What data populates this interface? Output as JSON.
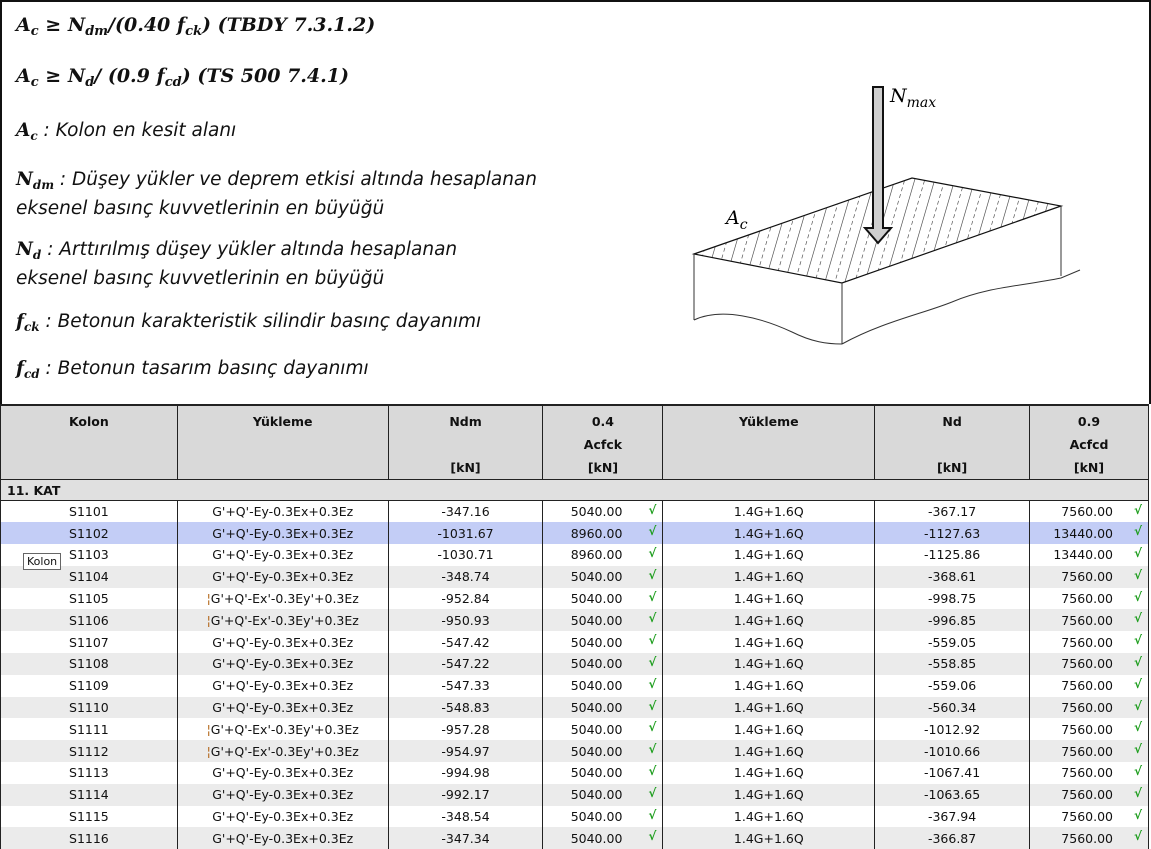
{
  "formulas": [
    {
      "seg": [
        [
          "A",
          "c"
        ],
        [
          " ≥ ",
          ""
        ],
        [
          "N",
          "dm"
        ],
        [
          "/(0.40 ",
          ""
        ],
        [
          "f",
          "ck"
        ],
        [
          ")  (TBDY 7.3.1.2)",
          ""
        ]
      ]
    },
    {
      "seg": [
        [
          "A",
          "c"
        ],
        [
          " ≥ ",
          ""
        ],
        [
          "N",
          "d"
        ],
        [
          "/ (0.9 ",
          ""
        ],
        [
          "f",
          "cd"
        ],
        [
          ")     (TS 500 7.4.1)",
          ""
        ]
      ]
    }
  ],
  "definitions": [
    {
      "sym": "A",
      "sub": "c",
      "lines": [
        " : Kolon en kesit alanı"
      ]
    },
    {
      "sym": "N",
      "sub": "dm",
      "lines": [
        " : Düşey yükler ve deprem etkisi altında hesaplanan",
        "eksenel basınç kuvvetlerinin en büyüğü"
      ]
    },
    {
      "sym": "N",
      "sub": "d",
      "lines": [
        " : Arttırılmış düşey yükler altında hesaplanan",
        "eksenel basınç kuvvetlerinin en büyüğü"
      ]
    },
    {
      "sym": "f",
      "sub": "ck",
      "lines": [
        " : Betonun karakteristik silindir basınç dayanımı"
      ]
    },
    {
      "sym": "f",
      "sub": "cd",
      "lines": [
        " : Betonun tasarım basınç dayanımı"
      ]
    }
  ],
  "diagram": {
    "load_label": "N",
    "load_sub": "max",
    "area_label": "A",
    "area_sub": "c"
  },
  "table": {
    "headers": [
      [
        "Kolon"
      ],
      [
        "Yükleme"
      ],
      [
        "Ndm",
        "",
        "[kN]"
      ],
      [
        "0.4",
        "Acfck",
        "[kN]"
      ],
      [
        "Yükleme"
      ],
      [
        "Nd",
        "",
        "[kN]"
      ],
      [
        "0.9",
        "Acfcd",
        "[kN]"
      ]
    ],
    "group": "11. KAT",
    "check": "√",
    "rows": [
      [
        "S1101",
        "G'+Q'-Ey-0.3Ex+0.3Ez",
        "-347.16",
        "5040.00",
        "1.4G+1.6Q",
        "-367.17",
        "7560.00"
      ],
      [
        "S1102",
        "G'+Q'-Ey-0.3Ex+0.3Ez",
        "-1031.67",
        "8960.00",
        "1.4G+1.6Q",
        "-1127.63",
        "13440.00"
      ],
      [
        "S1103",
        "G'+Q'-Ey-0.3Ex+0.3Ez",
        "-1030.71",
        "8960.00",
        "1.4G+1.6Q",
        "-1125.86",
        "13440.00"
      ],
      [
        "S1104",
        "G'+Q'-Ey-0.3Ex+0.3Ez",
        "-348.74",
        "5040.00",
        "1.4G+1.6Q",
        "-368.61",
        "7560.00"
      ],
      [
        "S1105",
        "G'+Q'-Ex'-0.3Ey'+0.3Ez",
        "-952.84",
        "5040.00",
        "1.4G+1.6Q",
        "-998.75",
        "7560.00"
      ],
      [
        "S1106",
        "G'+Q'-Ex'-0.3Ey'+0.3Ez",
        "-950.93",
        "5040.00",
        "1.4G+1.6Q",
        "-996.85",
        "7560.00"
      ],
      [
        "S1107",
        "G'+Q'-Ey-0.3Ex+0.3Ez",
        "-547.42",
        "5040.00",
        "1.4G+1.6Q",
        "-559.05",
        "7560.00"
      ],
      [
        "S1108",
        "G'+Q'-Ey-0.3Ex+0.3Ez",
        "-547.22",
        "5040.00",
        "1.4G+1.6Q",
        "-558.85",
        "7560.00"
      ],
      [
        "S1109",
        "G'+Q'-Ey-0.3Ex+0.3Ez",
        "-547.33",
        "5040.00",
        "1.4G+1.6Q",
        "-559.06",
        "7560.00"
      ],
      [
        "S1110",
        "G'+Q'-Ey-0.3Ex+0.3Ez",
        "-548.83",
        "5040.00",
        "1.4G+1.6Q",
        "-560.34",
        "7560.00"
      ],
      [
        "S1111",
        "G'+Q'-Ex'-0.3Ey'+0.3Ez",
        "-957.28",
        "5040.00",
        "1.4G+1.6Q",
        "-1012.92",
        "7560.00"
      ],
      [
        "S1112",
        "G'+Q'-Ex'-0.3Ey'+0.3Ez",
        "-954.97",
        "5040.00",
        "1.4G+1.6Q",
        "-1010.66",
        "7560.00"
      ],
      [
        "S1113",
        "G'+Q'-Ey-0.3Ex+0.3Ez",
        "-994.98",
        "5040.00",
        "1.4G+1.6Q",
        "-1067.41",
        "7560.00"
      ],
      [
        "S1114",
        "G'+Q'-Ey-0.3Ex+0.3Ez",
        "-992.17",
        "5040.00",
        "1.4G+1.6Q",
        "-1063.65",
        "7560.00"
      ],
      [
        "S1115",
        "G'+Q'-Ey-0.3Ex+0.3Ez",
        "-348.54",
        "5040.00",
        "1.4G+1.6Q",
        "-367.94",
        "7560.00"
      ],
      [
        "S1116",
        "G'+Q'-Ey-0.3Ex+0.3Ez",
        "-347.34",
        "5040.00",
        "1.4G+1.6Q",
        "-366.87",
        "7560.00"
      ]
    ],
    "selected_row": 1,
    "marked_rows": [
      4,
      5,
      10,
      11
    ]
  },
  "tooltip": "Kolon",
  "colors": {
    "selected": "#c3cdf6",
    "check": "#1e9e1e",
    "header": "#d9d9d9"
  }
}
